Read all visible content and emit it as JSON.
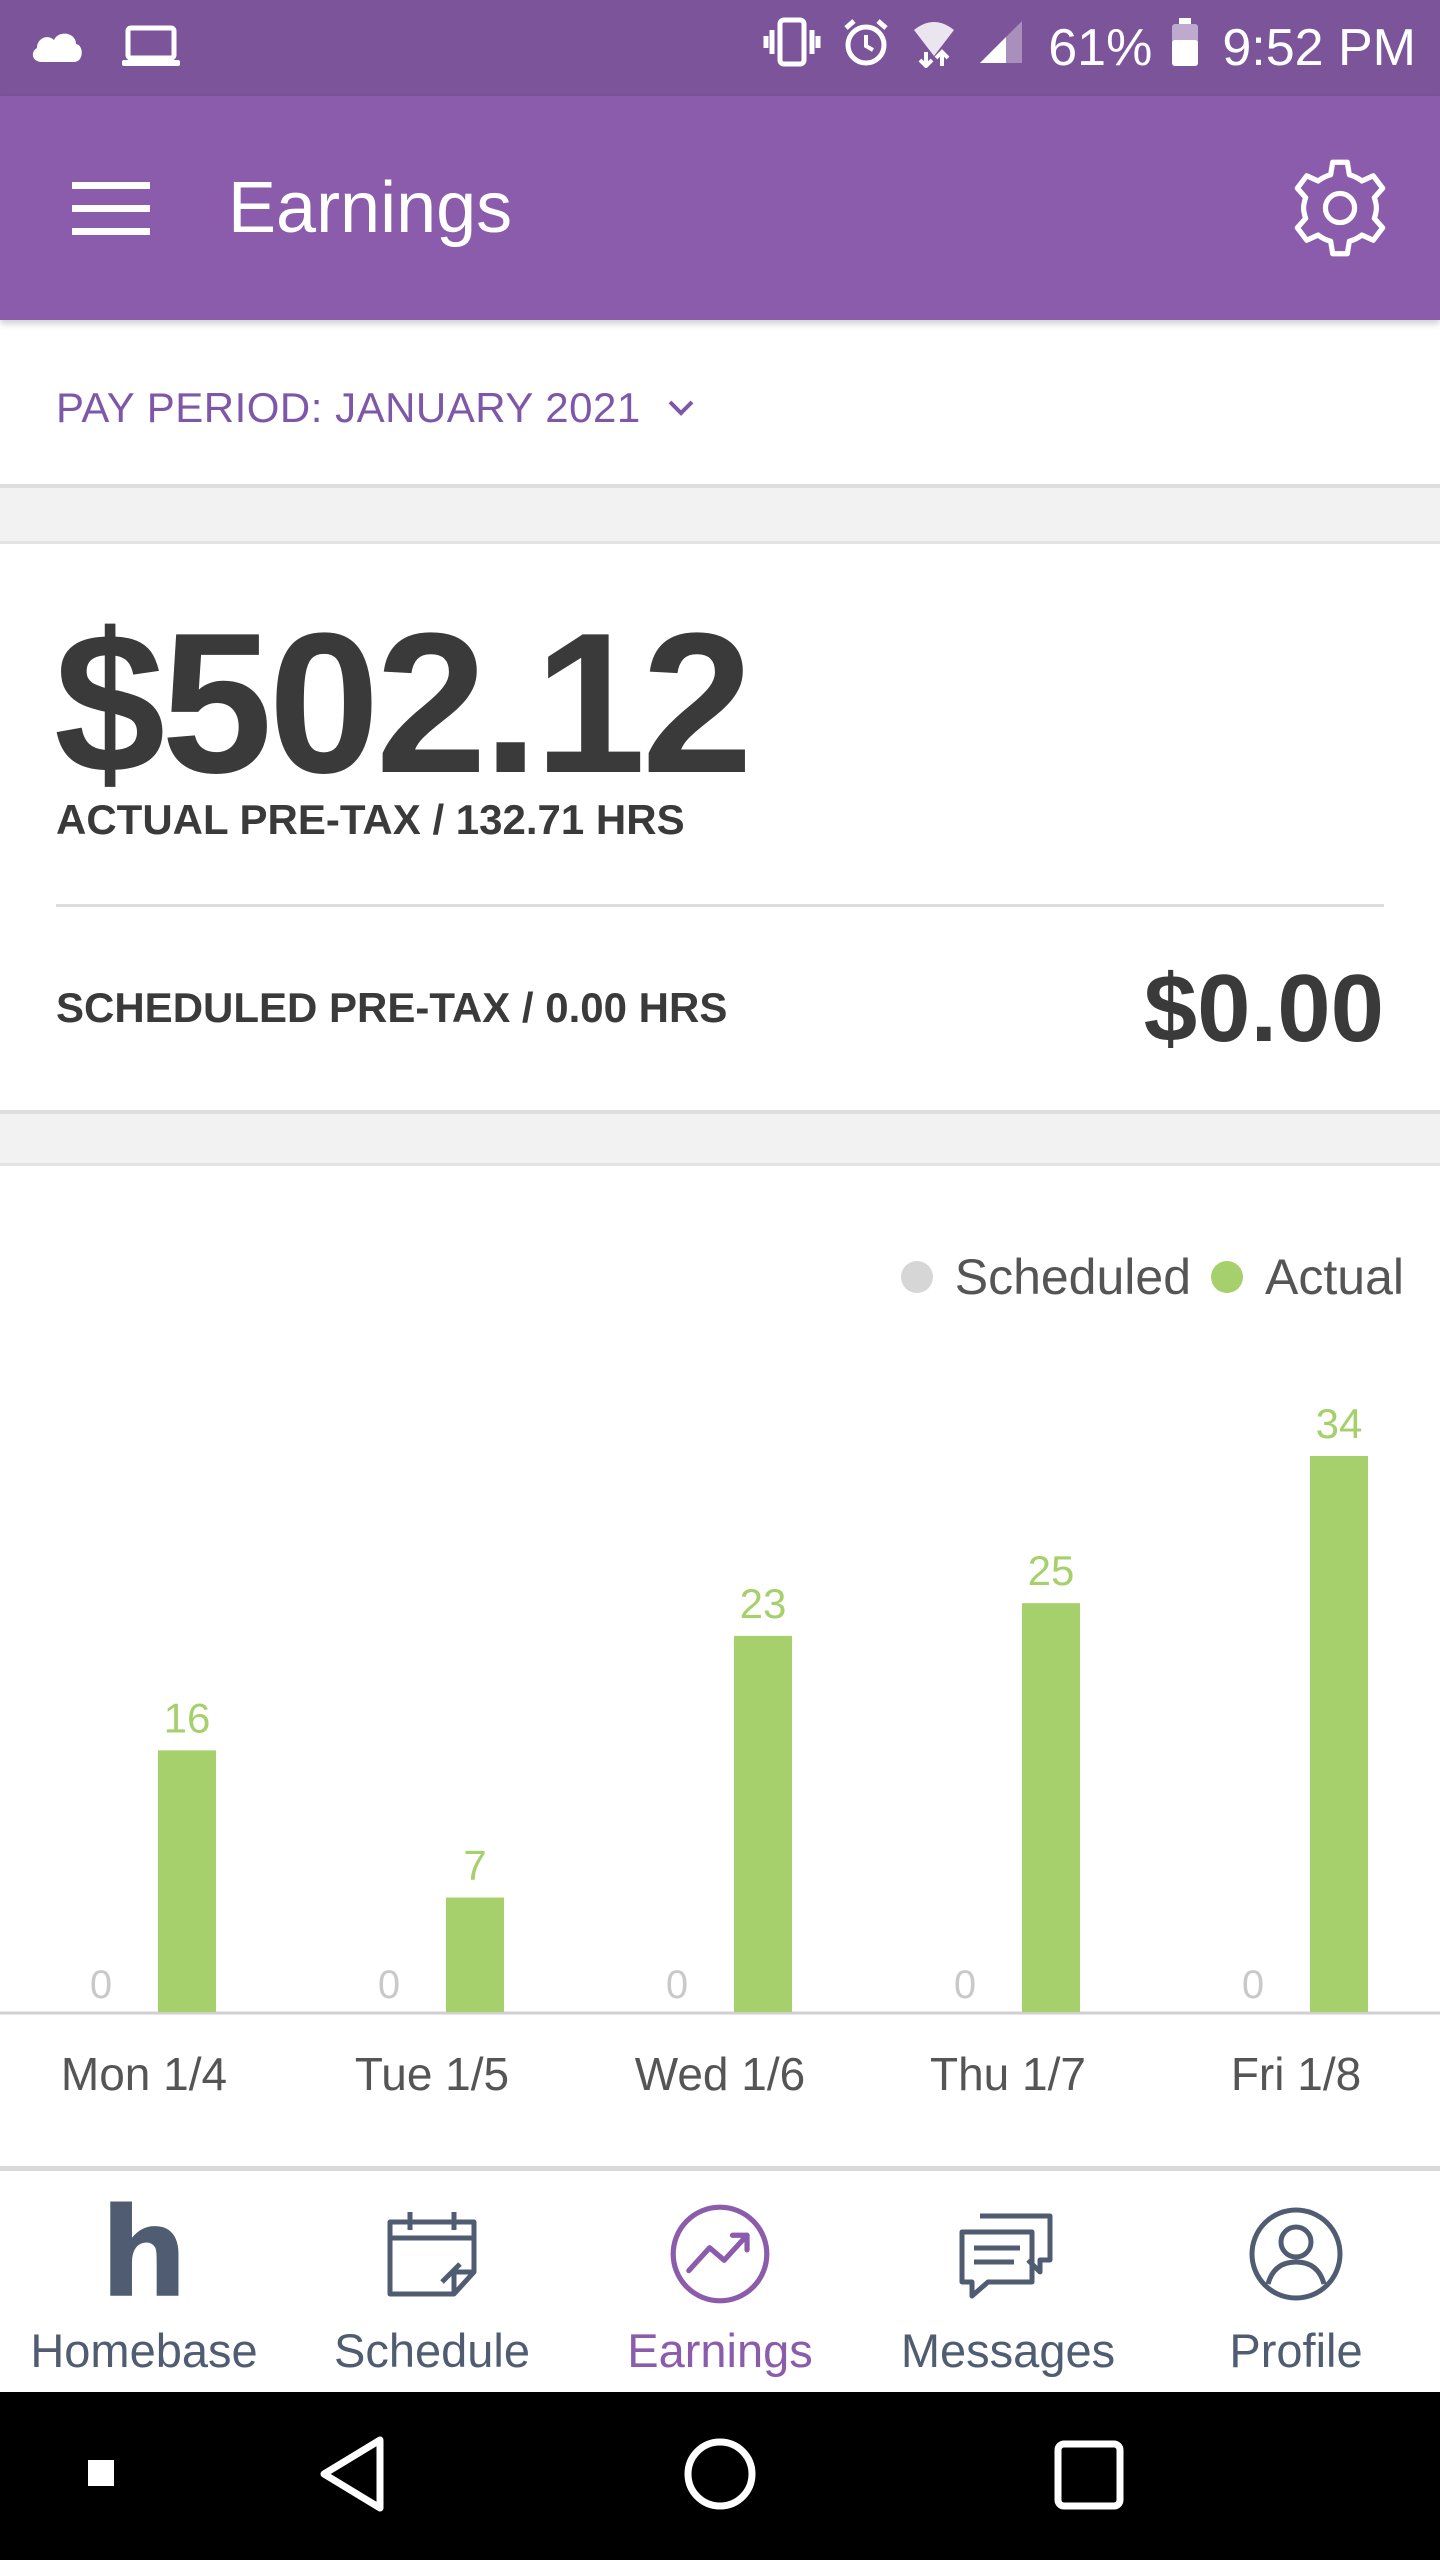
{
  "status_bar": {
    "battery_percent": "61%",
    "time": "9:52 PM"
  },
  "app_bar": {
    "title": "Earnings"
  },
  "pay_period": {
    "label": "PAY PERIOD: JANUARY 2021"
  },
  "summary": {
    "actual_amount": "$502.12",
    "actual_label": "ACTUAL PRE-TAX / 132.71 HRS",
    "scheduled_label": "SCHEDULED PRE-TAX / 0.00 HRS",
    "scheduled_amount": "$0.00"
  },
  "legend": {
    "scheduled": "Scheduled",
    "actual": "Actual"
  },
  "colors": {
    "brand_purple": "#8a5cab",
    "status_purple": "#7b5499",
    "actual_green": "#a6d06b",
    "scheduled_gray": "#d6d6d6",
    "nav_gray": "#4f5c72"
  },
  "chart_data": {
    "type": "bar",
    "categories": [
      "Mon 1/4",
      "Tue 1/5",
      "Wed 1/6",
      "Thu 1/7",
      "Fri 1/8"
    ],
    "series": [
      {
        "name": "Scheduled",
        "values": [
          0,
          0,
          0,
          0,
          0
        ]
      },
      {
        "name": "Actual",
        "values": [
          16,
          7,
          23,
          25,
          34
        ]
      }
    ],
    "ylim": [
      0,
      34
    ],
    "legend_position": "top-right",
    "grid": false
  },
  "bottom_nav": {
    "items": [
      {
        "label": "Homebase",
        "icon": "homebase-logo-icon"
      },
      {
        "label": "Schedule",
        "icon": "calendar-icon"
      },
      {
        "label": "Earnings",
        "icon": "earnings-trend-icon"
      },
      {
        "label": "Messages",
        "icon": "messages-icon"
      },
      {
        "label": "Profile",
        "icon": "profile-icon"
      }
    ],
    "active_index": 2
  }
}
